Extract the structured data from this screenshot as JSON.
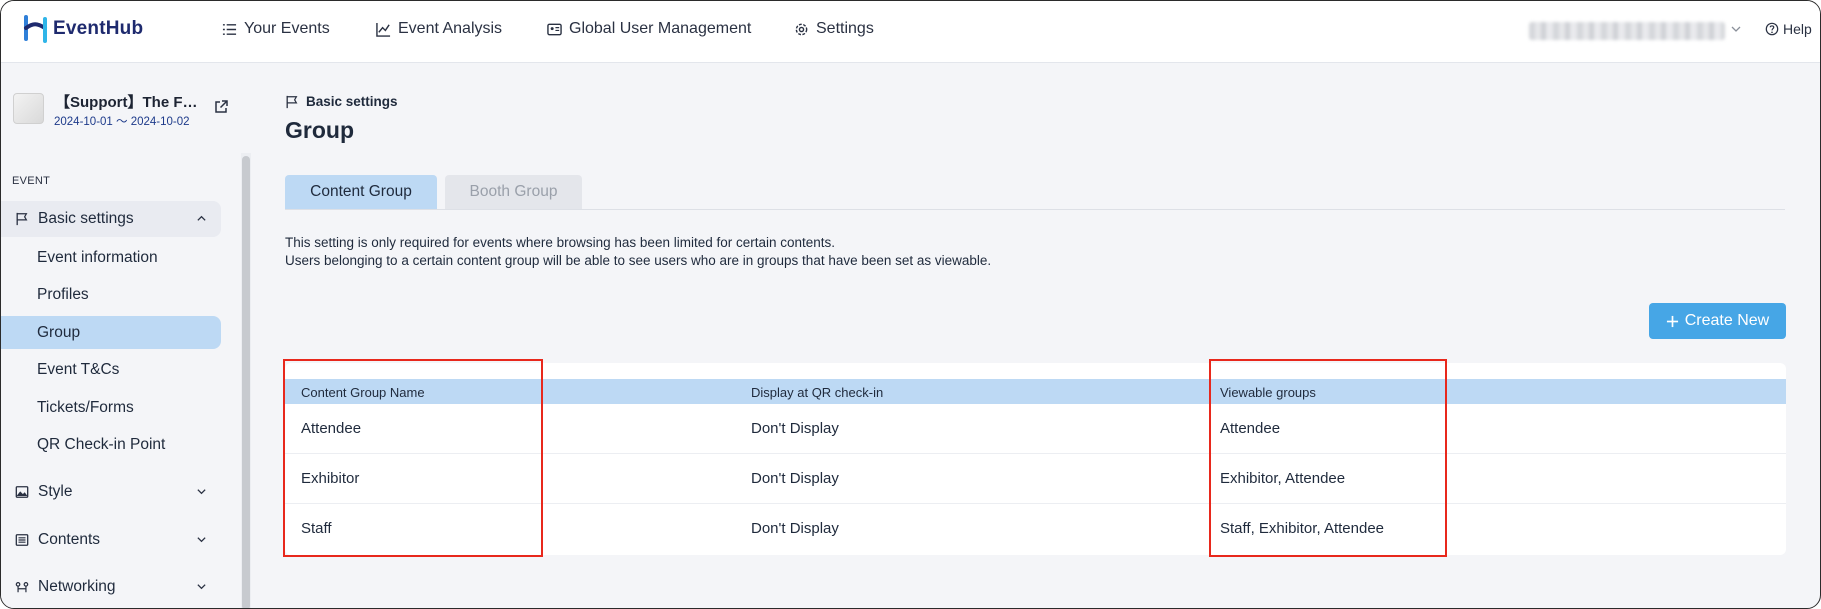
{
  "app": {
    "brand": "EventHub"
  },
  "nav": [
    {
      "label": "Your Events",
      "icon": "list-icon"
    },
    {
      "label": "Event Analysis",
      "icon": "chart-line-icon"
    },
    {
      "label": "Global User Management",
      "icon": "id-card-icon"
    },
    {
      "label": "Settings",
      "icon": "gear-icon"
    }
  ],
  "help_label": "Help",
  "event": {
    "title": "【Support】The F…",
    "dates": "2024-10-01 〜 2024-10-02"
  },
  "sidebar": {
    "section": "EVENT",
    "groups": {
      "basic": "Basic settings",
      "style": "Style",
      "contents": "Contents",
      "networking": "Networking"
    },
    "items": [
      "Event information",
      "Profiles",
      "Group",
      "Event T&Cs",
      "Tickets/Forms",
      "QR Check-in Point"
    ],
    "selected_item": "Group"
  },
  "breadcrumb": "Basic settings",
  "page_title": "Group",
  "tabs": {
    "content": "Content Group",
    "booth": "Booth Group"
  },
  "description": {
    "line1": "This setting is only required for events where browsing has been limited for certain contents.",
    "line2": "Users belonging to a certain content group will be able to see users who are in groups that have been set as viewable."
  },
  "create_button": "Create New",
  "table": {
    "headers": {
      "name": "Content Group Name",
      "qr": "Display at QR check-in",
      "viewable": "Viewable groups"
    },
    "rows": [
      {
        "name": "Attendee",
        "qr": "Don't Display",
        "viewable": "Attendee"
      },
      {
        "name": "Exhibitor",
        "qr": "Don't Display",
        "viewable": "Exhibitor, Attendee"
      },
      {
        "name": "Staff",
        "qr": "Don't Display",
        "viewable": "Staff, Exhibitor, Attendee"
      }
    ]
  },
  "colors": {
    "accent": "#46a6e6",
    "selected": "#bdd9f4",
    "highlight": "#e8281c",
    "brand": "#1e2a6e"
  }
}
